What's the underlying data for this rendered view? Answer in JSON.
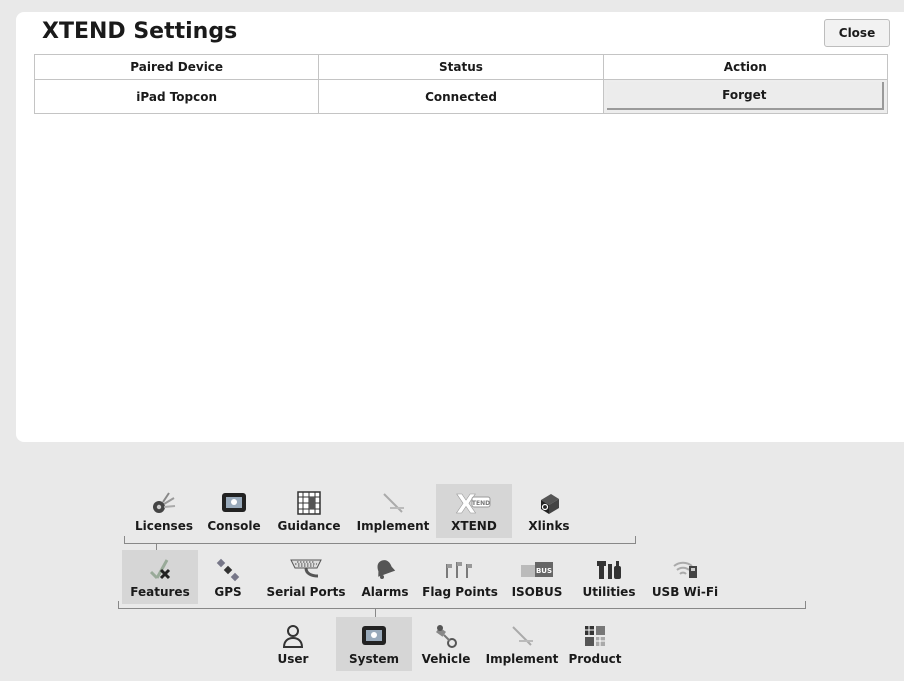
{
  "dialog": {
    "title": "XTEND Settings",
    "close_label": "Close"
  },
  "table": {
    "headers": [
      "Paired Device",
      "Status",
      "Action"
    ],
    "rows": [
      {
        "device": "iPad Topcon",
        "status": "Connected",
        "action": "Forget"
      }
    ]
  },
  "nav": {
    "row1": [
      {
        "label": "Licenses",
        "icon": "licenses-icon"
      },
      {
        "label": "Console",
        "icon": "console-icon"
      },
      {
        "label": "Guidance",
        "icon": "guidance-grid-icon"
      },
      {
        "label": "Implement",
        "icon": "implement-icon"
      },
      {
        "label": "XTEND",
        "icon": "xtend-icon",
        "selected": true
      },
      {
        "label": "Xlinks",
        "icon": "xlinks-icon"
      }
    ],
    "row2": [
      {
        "label": "Features",
        "icon": "features-icon",
        "selected": true
      },
      {
        "label": "GPS",
        "icon": "gps-satellite-icon"
      },
      {
        "label": "Serial Ports",
        "icon": "serial-ports-icon"
      },
      {
        "label": "Alarms",
        "icon": "alarm-bell-icon"
      },
      {
        "label": "Flag Points",
        "icon": "flag-points-icon"
      },
      {
        "label": "ISOBUS",
        "icon": "isobus-icon",
        "badge": "BUS"
      },
      {
        "label": "Utilities",
        "icon": "utilities-icon"
      },
      {
        "label": "USB Wi-Fi",
        "icon": "usb-wifi-icon"
      }
    ],
    "row3": [
      {
        "label": "User",
        "icon": "user-icon"
      },
      {
        "label": "System",
        "icon": "system-icon",
        "selected": true
      },
      {
        "label": "Vehicle",
        "icon": "vehicle-icon"
      },
      {
        "label": "Implement",
        "icon": "implement-icon"
      },
      {
        "label": "Product",
        "icon": "product-icon"
      }
    ],
    "xtend_badge": "TEND"
  },
  "colors": {
    "selected_bg": "#d6d6d6",
    "panel_bg": "#ffffff",
    "page_bg": "#e9e9e9"
  }
}
